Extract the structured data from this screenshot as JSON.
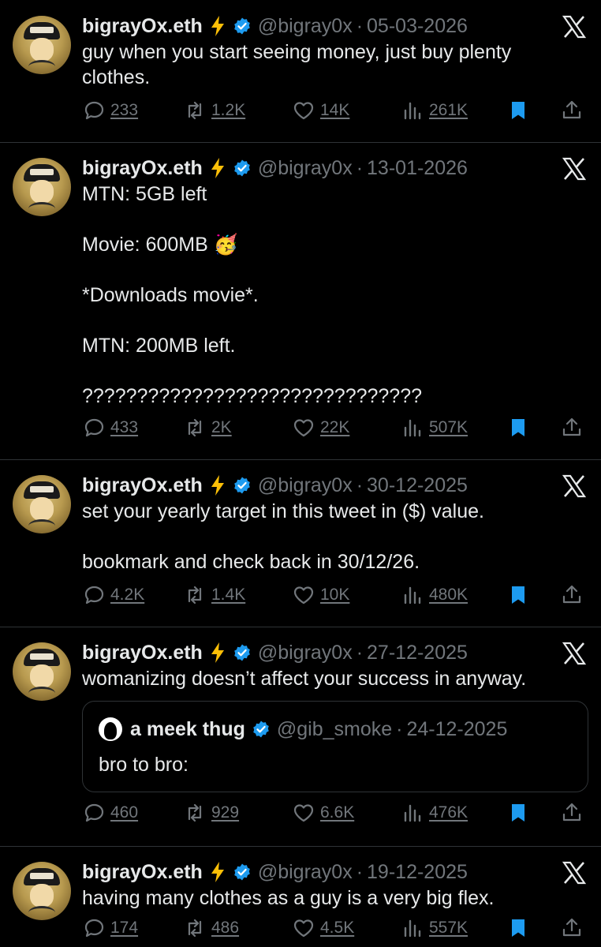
{
  "author": {
    "name": "bigrayOx.eth",
    "handle": "@bigray0x"
  },
  "colors": {
    "accent": "#1d9bf0",
    "muted": "#71767b",
    "text": "#e7e9ea",
    "bolt": "#fcbf07"
  },
  "tweets": [
    {
      "date": "05-03-2026",
      "text": "guy when you start seeing money, just buy plenty\nclothes.",
      "stats": {
        "replies": "233",
        "retweets": "1.2K",
        "likes": "14K",
        "views": "261K"
      }
    },
    {
      "date": "13-01-2026",
      "text": "MTN: 5GB left\n\nMovie: 600MB 🥳\n\n*Downloads movie*.\n\nMTN: 200MB left.\n\n???????????????????????????????",
      "stats": {
        "replies": "433",
        "retweets": "2K",
        "likes": "22K",
        "views": "507K"
      }
    },
    {
      "date": "30-12-2025",
      "text": "set your yearly target in this tweet in ($) value.\n\nbookmark and check back in 30/12/26.",
      "stats": {
        "replies": "4.2K",
        "retweets": "1.4K",
        "likes": "10K",
        "views": "480K"
      }
    },
    {
      "date": "27-12-2025",
      "text": "womanizing doesn’t affect your success in anyway.",
      "quote": {
        "name": "a meek thug",
        "handle": "@gib_smoke",
        "date": "24-12-2025",
        "text": "bro to bro:"
      },
      "stats": {
        "replies": "460",
        "retweets": "929",
        "likes": "6.6K",
        "views": "476K"
      }
    },
    {
      "date": "19-12-2025",
      "text": "having many clothes as a guy is a very big flex.",
      "stats": {
        "replies": "174",
        "retweets": "486",
        "likes": "4.5K",
        "views": "557K"
      }
    }
  ]
}
